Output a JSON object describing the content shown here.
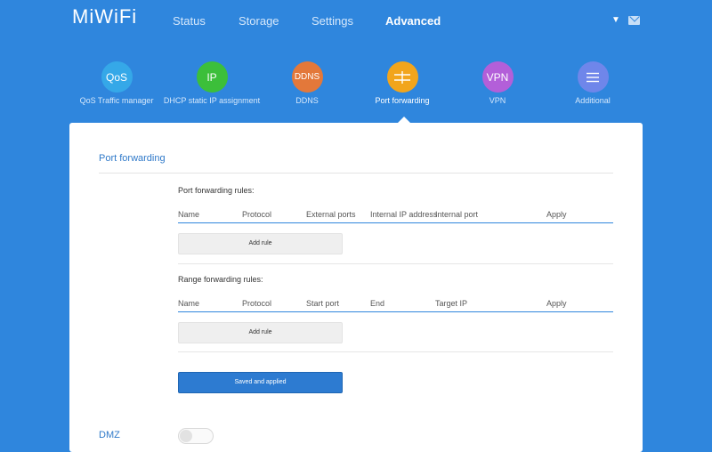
{
  "app": {
    "logo": "MiWiFi"
  },
  "nav": [
    {
      "label": "Status",
      "active": false
    },
    {
      "label": "Storage",
      "active": false
    },
    {
      "label": "Settings",
      "active": false
    },
    {
      "label": "Advanced",
      "active": true
    }
  ],
  "top_icons": [
    "chevron-down-icon",
    "mail-icon"
  ],
  "subnav": [
    {
      "icon_text": "QoS",
      "label": "QoS Traffic manager",
      "color": "#35a8e8",
      "active": false
    },
    {
      "icon_text": "IP",
      "label": "DHCP static IP assignment",
      "color": "#3cbf3a",
      "active": false
    },
    {
      "icon_text": "DDNS",
      "label": "DDNS",
      "color": "#e3783a",
      "active": false
    },
    {
      "icon_text": "",
      "icon": "port-forwarding-icon",
      "label": "Port forwarding",
      "color": "#f2a51c",
      "active": true
    },
    {
      "icon_text": "VPN",
      "label": "VPN",
      "color": "#b35fd9",
      "active": false
    },
    {
      "icon_text": "",
      "icon": "menu-icon",
      "label": "Additional",
      "color": "#6f86ea",
      "active": false
    }
  ],
  "main": {
    "section_title": "Port forwarding",
    "port_rules": {
      "title": "Port forwarding rules:",
      "columns": [
        "Name",
        "Protocol",
        "External ports",
        "Internal IP address",
        "Internal port",
        "Apply"
      ],
      "add_button": "Add rule"
    },
    "range_rules": {
      "title": "Range forwarding rules:",
      "columns": [
        "Name",
        "Protocol",
        "Start port",
        "End",
        "Target IP",
        "Apply"
      ],
      "add_button": "Add rule"
    },
    "save_button": "Saved and applied",
    "dmz": {
      "label": "DMZ",
      "enabled": false
    }
  }
}
